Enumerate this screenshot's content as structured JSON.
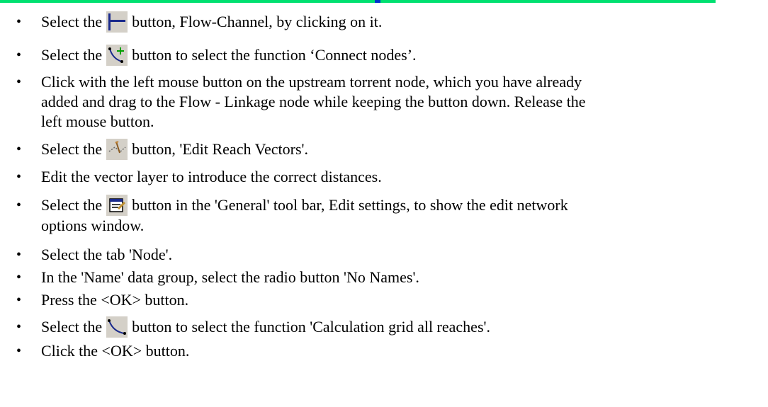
{
  "items": [
    {
      "pre": "Select the",
      "post": "button, Flow-Channel, by clicking on it.",
      "icon": "flow-channel-icon"
    },
    {
      "pre": "Select the",
      "post": "button to select the function ‘Connect nodes’.",
      "icon": "connect-nodes-icon"
    },
    {
      "lines": [
        "Click with the left mouse button on the upstream torrent node, which you have already",
        "added and drag to the Flow - Linkage node while keeping the button down. Release the",
        "left mouse button."
      ]
    },
    {
      "pre": "Select the",
      "post": "button, 'Edit Reach Vectors'.",
      "icon": "edit-reach-vectors-icon"
    },
    {
      "lines": [
        "Edit the vector layer to introduce the correct distances."
      ]
    },
    {
      "pre": "Select the",
      "post": "button in the 'General' tool bar, Edit settings, to show the edit network",
      "icon": "edit-settings-icon",
      "cont": "options window."
    },
    {
      "lines": [
        "Select the tab 'Node'."
      ]
    },
    {
      "lines": [
        "In the 'Name' data group, select the radio button 'No Names'."
      ]
    },
    {
      "lines": [
        "Press the <OK> button."
      ]
    },
    {
      "pre": "Select the",
      "post": "button to select the function 'Calculation grid all reaches'.",
      "icon": "calculation-grid-icon"
    },
    {
      "lines": [
        "Click the <OK> button."
      ]
    }
  ],
  "bullet": "•"
}
